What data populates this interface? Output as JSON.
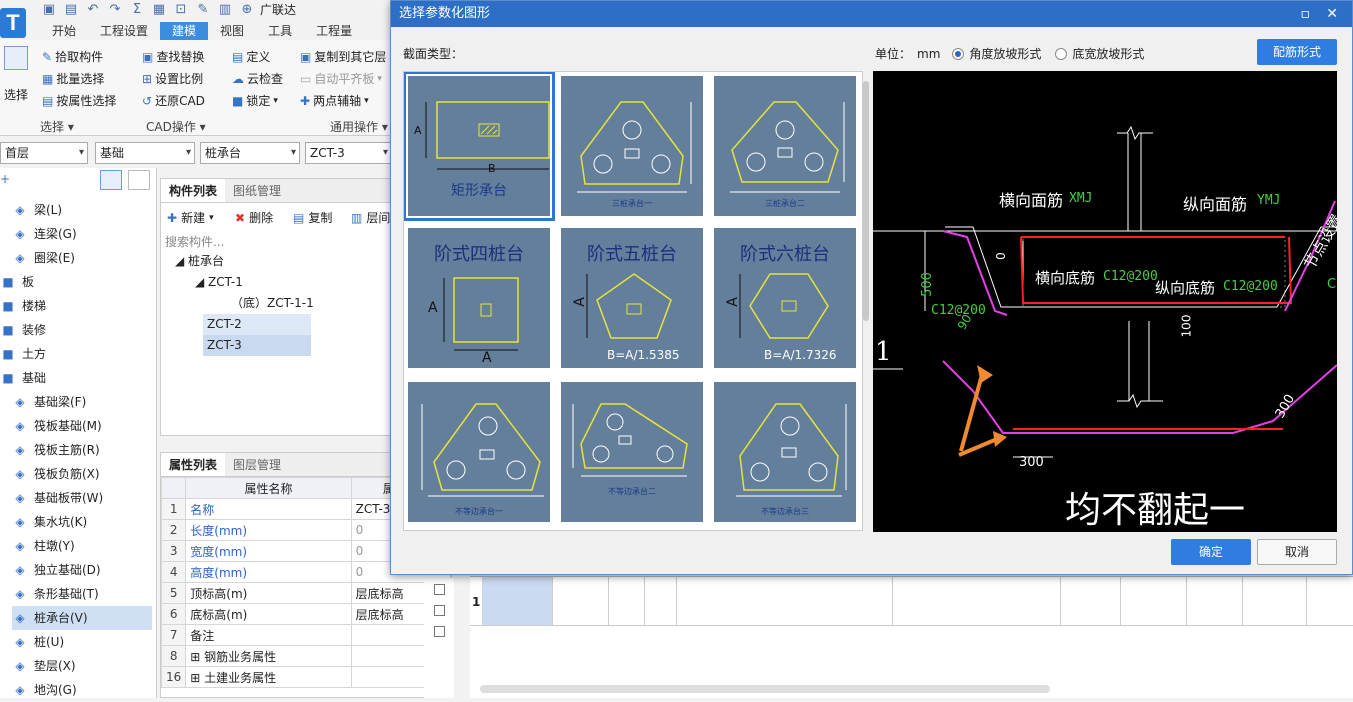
{
  "app": {
    "logo": "T",
    "title_fragment": "广联达"
  },
  "menu_tabs": [
    "开始",
    "工程设置",
    "建模",
    "视图",
    "工具",
    "工程量"
  ],
  "ribbon": {
    "select_label": "选择",
    "col1": [
      "拾取构件",
      "批量选择",
      "按属性选择"
    ],
    "col2": [
      "查找替换",
      "设置比例",
      "还原CAD"
    ],
    "col3": [
      "定义",
      "云检查",
      "锁定"
    ],
    "col4": [
      "复制到其它层",
      "自动平齐板",
      "两点辅轴"
    ],
    "groups": [
      "选择",
      "CAD操作",
      "通用操作"
    ]
  },
  "combos": [
    "首层",
    "基础",
    "桩承台",
    "ZCT-3"
  ],
  "nav": [
    {
      "label": "梁(L)",
      "icon": "beam-icon"
    },
    {
      "label": "连梁(G)",
      "icon": "link-beam-icon"
    },
    {
      "label": "圈梁(E)",
      "icon": "ring-beam-icon"
    },
    {
      "label": "板",
      "icon": "folder-icon"
    },
    {
      "label": "楼梯",
      "icon": "folder-icon"
    },
    {
      "label": "装修",
      "icon": "folder-icon"
    },
    {
      "label": "土方",
      "icon": "folder-icon"
    },
    {
      "label": "基础",
      "icon": "folder-icon"
    },
    {
      "label": "基础梁(F)",
      "icon": "foundation-beam-icon"
    },
    {
      "label": "筏板基础(M)",
      "icon": "raft-icon"
    },
    {
      "label": "筏板主筋(R)",
      "icon": "raft-main-rebar-icon"
    },
    {
      "label": "筏板负筋(X)",
      "icon": "raft-neg-rebar-icon"
    },
    {
      "label": "基础板带(W)",
      "icon": "strip-icon"
    },
    {
      "label": "集水坑(K)",
      "icon": "sump-icon"
    },
    {
      "label": "柱墩(Y)",
      "icon": "pier-icon"
    },
    {
      "label": "独立基础(D)",
      "icon": "isolated-footing-icon"
    },
    {
      "label": "条形基础(T)",
      "icon": "strip-footing-icon"
    },
    {
      "label": "桩承台(V)",
      "icon": "pile-cap-icon"
    },
    {
      "label": "桩(U)",
      "icon": "pile-icon"
    },
    {
      "label": "垫层(X)",
      "icon": "cushion-icon"
    },
    {
      "label": "地沟(G)",
      "icon": "trench-icon"
    }
  ],
  "complist": {
    "tabs": [
      "构件列表",
      "图纸管理"
    ],
    "tools": [
      "新建",
      "删除",
      "复制",
      "层间"
    ],
    "search_placeholder": "搜索构件...",
    "tree": [
      "桩承台",
      "ZCT-1",
      "（底）ZCT-1-1",
      "ZCT-2",
      "ZCT-3"
    ]
  },
  "proplist": {
    "tabs": [
      "属性列表",
      "图层管理"
    ],
    "headers": [
      "属性名称",
      "属性值"
    ],
    "rows": [
      {
        "n": "1",
        "name": "名称",
        "value": "ZCT-3"
      },
      {
        "n": "2",
        "name": "长度(mm)",
        "value": "0"
      },
      {
        "n": "3",
        "name": "宽度(mm)",
        "value": "0"
      },
      {
        "n": "4",
        "name": "高度(mm)",
        "value": "0"
      },
      {
        "n": "5",
        "name": "顶标高(m)",
        "value": "层底标高"
      },
      {
        "n": "6",
        "name": "底标高(m)",
        "value": "层底标高"
      },
      {
        "n": "7",
        "name": "备注",
        "value": ""
      },
      {
        "n": "8",
        "name": "钢筋业务属性",
        "value": ""
      },
      {
        "n": "16",
        "name": "土建业务属性",
        "value": ""
      }
    ]
  },
  "grid": {
    "row_label": "1"
  },
  "dialog": {
    "title": "选择参数化图形",
    "section_label": "截面类型：",
    "unit_label": "单位：",
    "unit": "mm",
    "radio1": "角度放坡形式",
    "radio2": "底宽放坡形式",
    "rebar_button": "配筋形式",
    "ok": "确定",
    "cancel": "取消",
    "thumbs": [
      {
        "cap": "矩形承台",
        "dim1": "A",
        "dim2": "B"
      },
      {
        "cap": "三桩承台一"
      },
      {
        "cap": "三桩承台二"
      },
      {
        "cap": "阶式四桩台",
        "dim1": "A",
        "dim2": "A"
      },
      {
        "cap": "阶式五桩台",
        "dim1": "A",
        "dim2": "B=A/1.5385"
      },
      {
        "cap": "阶式六桩台",
        "dim1": "A",
        "dim2": "B=A/1.7326"
      },
      {
        "cap": "不等边承台一"
      },
      {
        "cap": "不等边承台二"
      },
      {
        "cap": "不等边承台三"
      }
    ],
    "preview": {
      "xmj": "横向面筋",
      "xmj_code": "XMJ",
      "ymj": "纵向面筋",
      "ymj_code": "YMJ",
      "hdj": "横向底筋",
      "hdj_code": "C12@200",
      "zdj": "纵向底筋",
      "zdj_code": "C12@200",
      "left_code": "C12@200",
      "h500": "500",
      "h0": "0",
      "h100": "100",
      "a90": "90",
      "d300a": "300",
      "d300b": "300",
      "big_text": "均不翻起一",
      "side_text": "节点设置",
      "mark": "1",
      "c_label": "C"
    }
  }
}
